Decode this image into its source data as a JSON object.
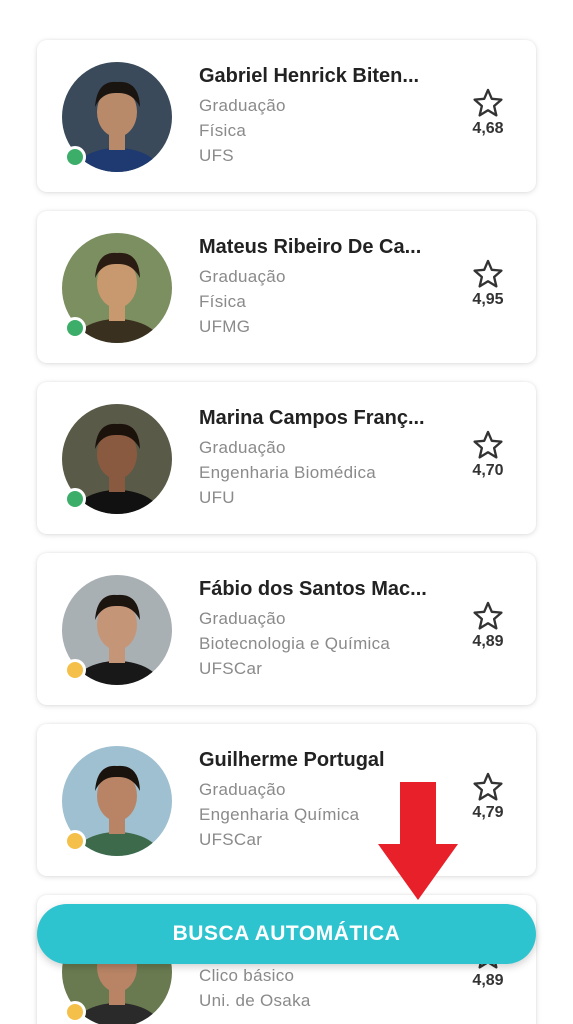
{
  "cards": [
    {
      "name": "Gabriel Henrick Biten...",
      "level": "Graduação",
      "course": "Física",
      "university": "UFS",
      "rating": "4,68",
      "status_color": "#3cae6a",
      "avatar_bg": "#3a4a5a",
      "avatar_hair": "#1a1410",
      "avatar_skin": "#b98a6a",
      "avatar_shirt": "#1e3a70"
    },
    {
      "name": "Mateus Ribeiro De Ca...",
      "level": "Graduação",
      "course": "Física",
      "university": "UFMG",
      "rating": "4,95",
      "status_color": "#3cae6a",
      "avatar_bg": "#7c8f60",
      "avatar_hair": "#2a1c12",
      "avatar_skin": "#c8996e",
      "avatar_shirt": "#3a3020"
    },
    {
      "name": "Marina Campos Franç...",
      "level": "Graduação",
      "course": "Engenharia Biomédica",
      "university": "UFU",
      "rating": "4,70",
      "status_color": "#3cae6a",
      "avatar_bg": "#5a5a48",
      "avatar_hair": "#1c120c",
      "avatar_skin": "#8a5a40",
      "avatar_shirt": "#111111"
    },
    {
      "name": "Fábio dos Santos Mac...",
      "level": "Graduação",
      "course": "Biotecnologia e Química",
      "university": "UFSCar",
      "rating": "4,89",
      "status_color": "#f4c04a",
      "avatar_bg": "#a9b0b4",
      "avatar_hair": "#1c140e",
      "avatar_skin": "#c59578",
      "avatar_shirt": "#181818"
    },
    {
      "name": "Guilherme Portugal",
      "level": "Graduação",
      "course": "Engenharia Química",
      "university": "UFSCar",
      "rating": "4,79",
      "status_color": "#f4c04a",
      "avatar_bg": "#9fc0d0",
      "avatar_hair": "#1a120c",
      "avatar_skin": "#b98466",
      "avatar_shirt": "#3c6a4a"
    },
    {
      "name": "",
      "level": "Clico básico",
      "course": "Uni. de Osaka",
      "university": "",
      "rating": "4,89",
      "status_color": "#f4c04a",
      "avatar_bg": "#6a7a50",
      "avatar_hair": "#1a120c",
      "avatar_skin": "#b98466",
      "avatar_shirt": "#2a2a2a"
    }
  ],
  "fab": {
    "label": "BUSCA AUTOMÁTICA",
    "color": "#2ec4cf"
  },
  "arrow": {
    "color": "#e8202a",
    "icon": "arrow-down-icon"
  },
  "rating_icon": "star-outline-icon"
}
